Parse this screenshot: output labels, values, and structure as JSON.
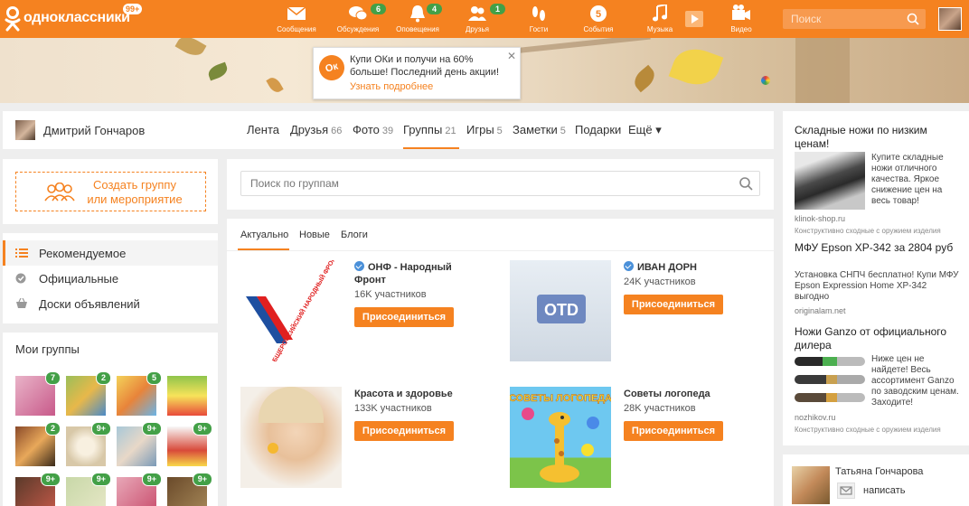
{
  "header": {
    "logo_text": "одноклассники",
    "logo_badge": "99+",
    "nav": [
      {
        "label": "Сообщения",
        "icon": "envelope-icon"
      },
      {
        "label": "Обсуждения",
        "icon": "chat-bubbles-icon",
        "badge": "6"
      },
      {
        "label": "Оповещения",
        "icon": "bell-icon",
        "badge": "4"
      },
      {
        "label": "Друзья",
        "icon": "people-icon",
        "badge": "1"
      },
      {
        "label": "Гости",
        "icon": "footprints-icon"
      },
      {
        "label": "События",
        "icon": "events-icon"
      },
      {
        "label": "Музыка",
        "icon": "music-note-icon"
      },
      {
        "label": "",
        "icon": "video-play-icon"
      },
      {
        "label": "Видео",
        "icon": "camera-icon"
      }
    ],
    "search_placeholder": "Поиск"
  },
  "promo": {
    "icon_text": "Ок",
    "text": "Купи ОКи и получи на 60% больше! Последний день акции!",
    "link": "Узнать подробнее"
  },
  "profile": {
    "name": "Дмитрий Гончаров",
    "tabs": [
      {
        "label": "Лента",
        "count": ""
      },
      {
        "label": "Друзья",
        "count": "66"
      },
      {
        "label": "Фото",
        "count": "39"
      },
      {
        "label": "Группы",
        "count": "21"
      },
      {
        "label": "Игры",
        "count": "5"
      },
      {
        "label": "Заметки",
        "count": "5"
      },
      {
        "label": "Подарки",
        "count": ""
      },
      {
        "label": "Ещё ▾",
        "count": ""
      }
    ]
  },
  "sidebar": {
    "create_label": "Создать группу или мероприятие",
    "menu": [
      {
        "label": "Рекомендуемое",
        "icon": "list-icon"
      },
      {
        "label": "Официальные",
        "icon": "check-circle-icon"
      },
      {
        "label": "Доски объявлений",
        "icon": "basket-icon"
      }
    ],
    "my_groups_title": "Мои группы",
    "my_groups": [
      {
        "badge": "7",
        "color": "#e9b3c8"
      },
      {
        "badge": "2",
        "color": "#9bbf5a"
      },
      {
        "badge": "5",
        "color": "#f3d25a"
      },
      {
        "badge": "",
        "color": "#8fc44b"
      },
      {
        "badge": "2",
        "color": "#8a4a2a"
      },
      {
        "badge": "9+",
        "color": "#d8c8a8"
      },
      {
        "badge": "9+",
        "color": "#a8c8d8"
      },
      {
        "badge": "9+",
        "color": "#d84a3a"
      },
      {
        "badge": "9+",
        "color": "#5a3a2a"
      },
      {
        "badge": "9+",
        "color": "#c8d8a8"
      },
      {
        "badge": "9+",
        "color": "#e8a8b8"
      },
      {
        "badge": "9+",
        "color": "#6a4a2a"
      }
    ]
  },
  "main": {
    "search_placeholder": "Поиск по группам",
    "subtabs": [
      "Актуально",
      "Новые",
      "Блоги"
    ],
    "join_label": "Присоединиться",
    "groups": [
      {
        "title": "ОНФ - Народный Фронт",
        "members": "16K участников",
        "verified": true,
        "image_text": "ОБЩЕРОССИЙСКИЙ НАРОДНЫЙ ФРОНТ"
      },
      {
        "title": "ИВАН ДОРН",
        "members": "24K участников",
        "verified": true,
        "image_text": "OTD"
      },
      {
        "title": "Красота и здоровье",
        "members": "133K участников",
        "verified": false,
        "image_text": ""
      },
      {
        "title": "Советы логопеда",
        "members": "28K участников",
        "verified": false,
        "image_text": "СОВЕТЫ ЛОГОПЕДА"
      }
    ]
  },
  "ads": [
    {
      "title": "Складные ножи по низким ценам!",
      "text": "Купите складные ножи отличного качества. Яркое снижение цен на весь товар!",
      "url": "klinok-shop.ru",
      "note": "Конструктивно сходные с оружием изделия"
    },
    {
      "title": "МФУ Epson XP-342 за 2804 руб",
      "text": "Установка СНПЧ бесплатно! Купи МФУ Epson Expression Home XP-342 выгодно",
      "url": "originalam.net",
      "note": ""
    },
    {
      "title": "Ножи Ganzo от официального дилера",
      "text": "Ниже цен не найдете! Весь ассортимент Ganzo по заводским ценам. Заходите!",
      "url": "nozhikov.ru",
      "note": "Конструктивно сходные с оружием изделия"
    }
  ],
  "friend": {
    "name": "Татьяна Гончарова",
    "action": "написать"
  },
  "colors": {
    "accent": "#f58220",
    "badge": "#43a047",
    "verified": "#4a90d9"
  }
}
